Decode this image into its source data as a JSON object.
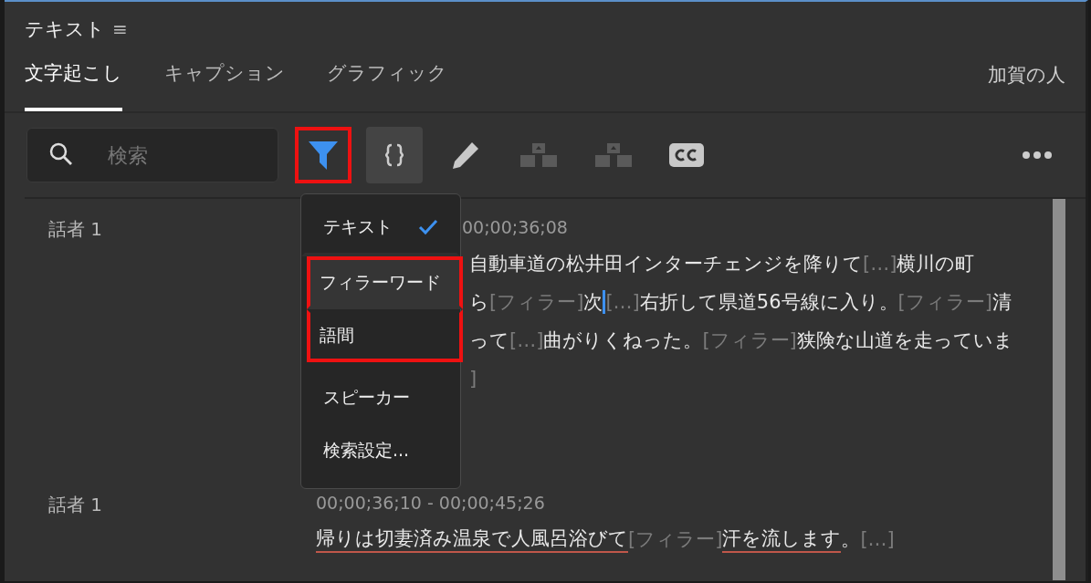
{
  "panel": {
    "title": "テキスト",
    "menu_glyph": "≡"
  },
  "tabs": [
    {
      "label": "文字起こし",
      "selected": true
    },
    {
      "label": "キャプション",
      "selected": false
    },
    {
      "label": "グラフィック",
      "selected": false
    }
  ],
  "sequence_name": "加賀の人",
  "search": {
    "placeholder": "検索"
  },
  "toolbar": [
    {
      "kind": "filter",
      "active": true,
      "pressed": false,
      "highlighted": true
    },
    {
      "kind": "merge",
      "active": false,
      "pressed": true,
      "highlighted": false
    },
    {
      "kind": "pencil",
      "active": false,
      "pressed": false,
      "highlighted": false
    },
    {
      "kind": "split",
      "active": false,
      "pressed": false,
      "highlighted": false
    },
    {
      "kind": "split2",
      "active": false,
      "pressed": false,
      "highlighted": false
    },
    {
      "kind": "cc",
      "active": false,
      "pressed": false,
      "highlighted": false
    },
    {
      "kind": "more",
      "active": false,
      "pressed": false,
      "highlighted": false
    }
  ],
  "filter_menu": [
    {
      "label": "テキスト",
      "checked": true,
      "hovered": false,
      "highlighted": false
    },
    {
      "label": "フィラーワード",
      "checked": false,
      "hovered": true,
      "highlighted": true
    },
    {
      "label": "語間",
      "checked": false,
      "hovered": false,
      "highlighted": true
    },
    {
      "label": "スピーカー",
      "checked": false,
      "hovered": false,
      "highlighted": false
    },
    {
      "label": "検索設定...",
      "checked": false,
      "hovered": false,
      "highlighted": false
    }
  ],
  "segments": [
    {
      "speaker": "話者 1",
      "time": "00;00;36;08",
      "lines": [
        [
          {
            "kind": "word",
            "text": "自動車道の松井田インターチェンジを降りて",
            "underlined": false
          },
          {
            "kind": "pause",
            "text": "[…]",
            "underlined": false
          },
          {
            "kind": "word",
            "text": "横川の町",
            "underlined": false
          }
        ],
        [
          {
            "kind": "word",
            "text": "ら",
            "underlined": false
          },
          {
            "kind": "filler",
            "text": "[フィラー]",
            "underlined": false
          },
          {
            "kind": "word",
            "text": "次",
            "underlined": false
          },
          {
            "kind": "cursor"
          },
          {
            "kind": "pause",
            "text": "[…]",
            "underlined": false
          },
          {
            "kind": "word",
            "text": "右折して県道56号線に入り。",
            "underlined": false
          },
          {
            "kind": "filler",
            "text": "[フィラー]",
            "underlined": false
          },
          {
            "kind": "word",
            "text": "清",
            "underlined": false
          }
        ],
        [
          {
            "kind": "word",
            "text": "って",
            "underlined": false
          },
          {
            "kind": "pause",
            "text": "[…]",
            "underlined": false
          },
          {
            "kind": "word",
            "text": "曲がりくねった。",
            "underlined": false
          },
          {
            "kind": "filler",
            "text": "[フィラー]",
            "underlined": false
          },
          {
            "kind": "word",
            "text": "狭険な山道を走っていま",
            "underlined": false
          }
        ],
        [
          {
            "kind": "pause",
            "text": "]",
            "underlined": false
          }
        ]
      ]
    },
    {
      "speaker": "話者 1",
      "time": "00;00;36;10 - 00;00;45;26",
      "lines": [
        [
          {
            "kind": "word",
            "text": "帰りは切妻済み温泉で人風呂浴びて",
            "underlined": true
          },
          {
            "kind": "filler",
            "text": "[フィラー]",
            "underlined": false
          },
          {
            "kind": "word",
            "text": "汗を流します",
            "underlined": true
          },
          {
            "kind": "word",
            "text": "。",
            "underlined": false
          },
          {
            "kind": "pause",
            "text": "[…]",
            "underlined": false
          }
        ]
      ]
    }
  ]
}
